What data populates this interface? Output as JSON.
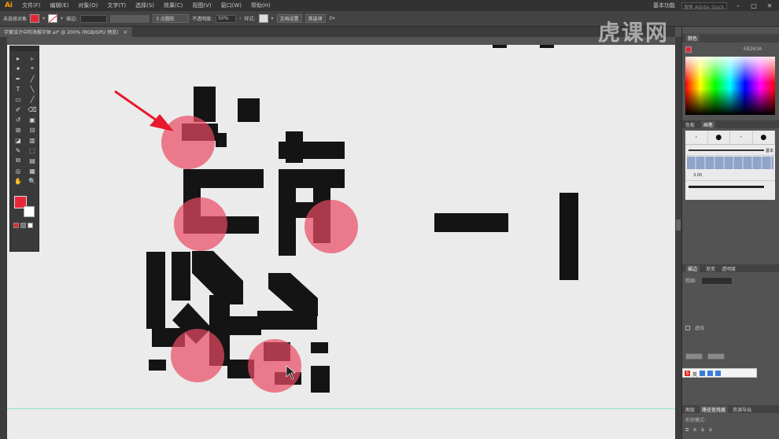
{
  "app": {
    "logo": "Ai"
  },
  "menubar": {
    "items": [
      "文件(F)",
      "编辑(E)",
      "对象(O)",
      "文字(T)",
      "选择(S)",
      "效果(C)",
      "视图(V)",
      "窗口(W)",
      "帮助(H)"
    ],
    "workspace": "基本功能",
    "search_placeholder": "搜索 Adobe Stock",
    "win_min": "–",
    "win_max": "□",
    "win_close": "✕"
  },
  "controlbar": {
    "selection_label": "未选择对象",
    "stroke_label": "描边:",
    "stroke_weight": "",
    "brush_def": "3 点圆形",
    "opacity_label": "不透明度:",
    "opacity_value": "50%",
    "style_label": "样式:",
    "doc_setup": "文档设置",
    "prefs": "首选项",
    "fill_color": "#e8263a"
  },
  "document_tab": {
    "title": "字蛋设计中的海报字体.ai* @ 200% (RGB/GPU 预览)",
    "close": "×"
  },
  "toolbox": {
    "tools": [
      "▸",
      "▹",
      "✦",
      "⌖",
      "✒",
      "╱",
      "T",
      "╲",
      "▭",
      "╱",
      "✐",
      "⌫",
      "↺",
      "▣",
      "⊞",
      "⊟",
      "◪",
      "▥",
      "✎",
      "⬚",
      "⧉",
      "▤",
      "◎",
      "▦",
      "✋",
      "🔍"
    ],
    "fill_color": "#e8263a"
  },
  "canvas": {
    "background": "#ebebeb",
    "glyph_color": "#141414",
    "highlight_color": "#e94a63",
    "arrow_color": "#e8192c"
  },
  "panels": {
    "color_tab": "颜色",
    "color_hex": "E8263A",
    "brushes_tabs": [
      "色板",
      "画笔"
    ],
    "brush_label_basic": "基本",
    "brush_size": "3.00",
    "transform_tabs": [
      "描边",
      "渐变",
      "透明度"
    ],
    "weight_label": "粗细:",
    "stroke_panel_label": "虚线",
    "dashes_label": "",
    "bottom_tabs": [
      "图层",
      "路径查找器",
      "资源导出"
    ],
    "shape_modes_label": "形状模式:",
    "ime_label": "英"
  },
  "watermark": {
    "text": "虎课网"
  }
}
